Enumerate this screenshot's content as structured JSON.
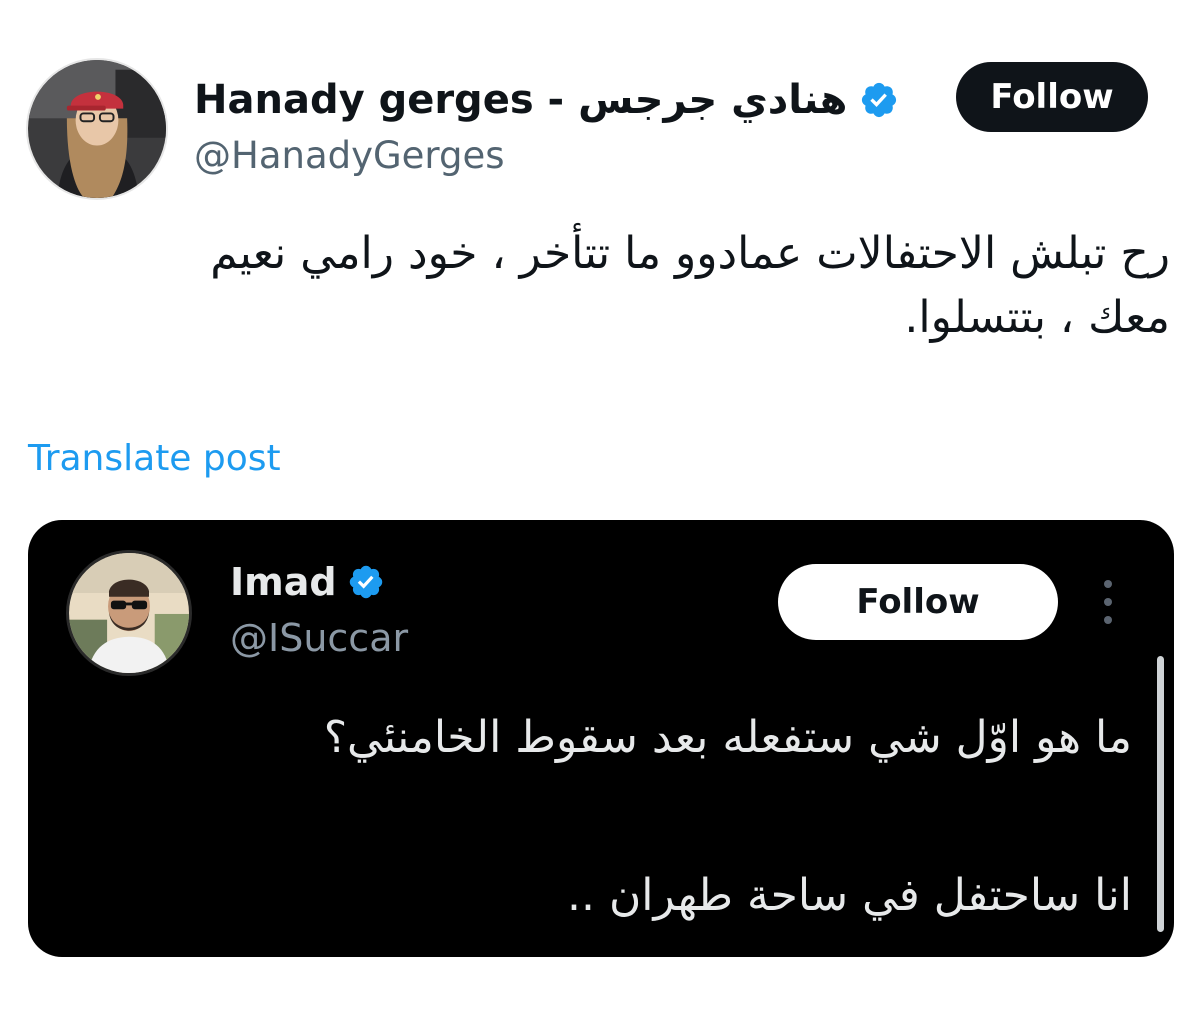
{
  "post": {
    "author": {
      "display_name": "Hanady gerges - هنادي جرجس",
      "handle": "@HanadyGerges",
      "verified": true,
      "avatar": "avatar-woman-red-cap"
    },
    "follow_label": "Follow",
    "text_line_1": "رح تبلش الاحتفالات عمادوو ما تتأخر ، خود رامي نعيم",
    "text_line_2": "معك ، بتتسلوا.",
    "translate_label": "Translate post"
  },
  "embedded_post": {
    "author": {
      "display_name": "Imad",
      "handle": "@ISuccar",
      "verified": true,
      "avatar": "avatar-man-sunglasses"
    },
    "follow_label": "Follow",
    "more_icon": "more-vertical-icon",
    "question": "ما هو اوّل شي ستفعله بعد سقوط الخامنئي؟",
    "answer": "انا ساحتفل في ساحة طهران .."
  },
  "colors": {
    "verified_badge": "#1d9bf0",
    "link": "#1d9bf0",
    "text": "#0f1419",
    "secondary_text": "#536471",
    "embed_background": "#000000"
  }
}
